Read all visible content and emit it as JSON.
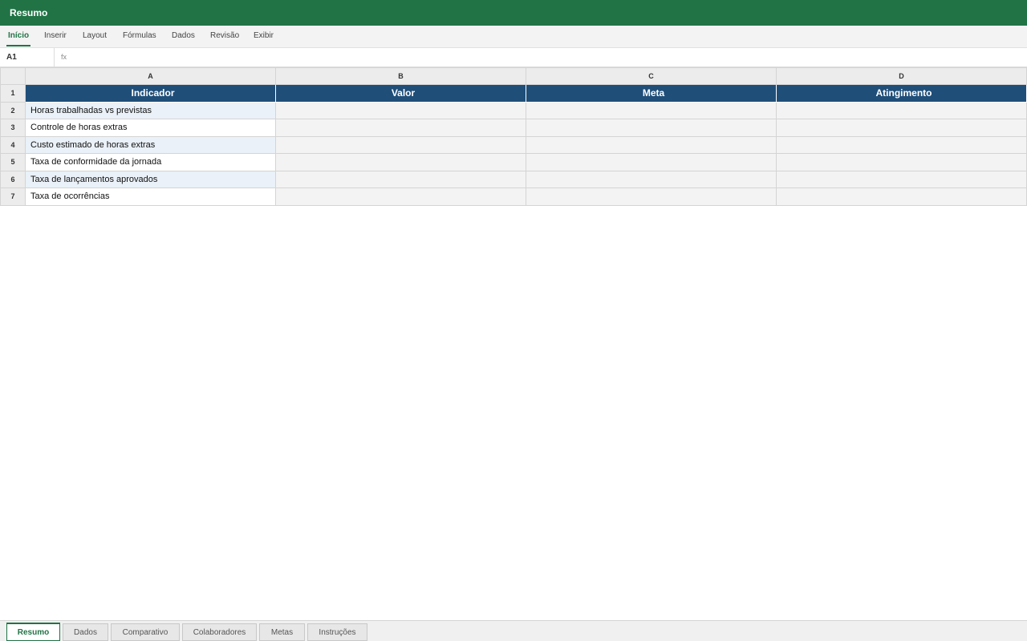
{
  "app": {
    "title": "Resumo"
  },
  "ribbon": {
    "tabs": [
      {
        "label": "Início",
        "active": true
      },
      {
        "label": "Inserir"
      },
      {
        "label": "Layout"
      },
      {
        "label": "Fórmulas"
      },
      {
        "label": "Dados"
      },
      {
        "label": "Revisão"
      },
      {
        "label": "Exibir"
      }
    ]
  },
  "formula_bar": {
    "cell_ref": "A1",
    "fx_label": "fx",
    "value": ""
  },
  "grid": {
    "columns": [
      "A",
      "B",
      "C",
      "D"
    ],
    "row_numbers": [
      "1",
      "2",
      "3",
      "4",
      "5",
      "6",
      "7"
    ],
    "header": [
      "Indicador",
      "Valor",
      "Meta",
      "Atingimento"
    ],
    "rows": [
      [
        "Horas trabalhadas vs previstas",
        "",
        "",
        ""
      ],
      [
        "Controle de horas extras",
        "",
        "",
        ""
      ],
      [
        "Custo estimado de horas extras",
        "",
        "",
        ""
      ],
      [
        "Taxa de conformidade da jornada",
        "",
        "",
        ""
      ],
      [
        "Taxa de lançamentos aprovados",
        "",
        "",
        ""
      ],
      [
        "Taxa de ocorrências",
        "",
        "",
        ""
      ]
    ]
  },
  "sheets": [
    {
      "label": "Resumo",
      "active": true
    },
    {
      "label": "Dados"
    },
    {
      "label": "Comparativo"
    },
    {
      "label": "Colaboradores"
    },
    {
      "label": "Metas"
    },
    {
      "label": "Instruções"
    }
  ],
  "colors": {
    "brand": "#217346",
    "header_fill": "#1f4e79",
    "band_fill": "#eaf1f8"
  }
}
